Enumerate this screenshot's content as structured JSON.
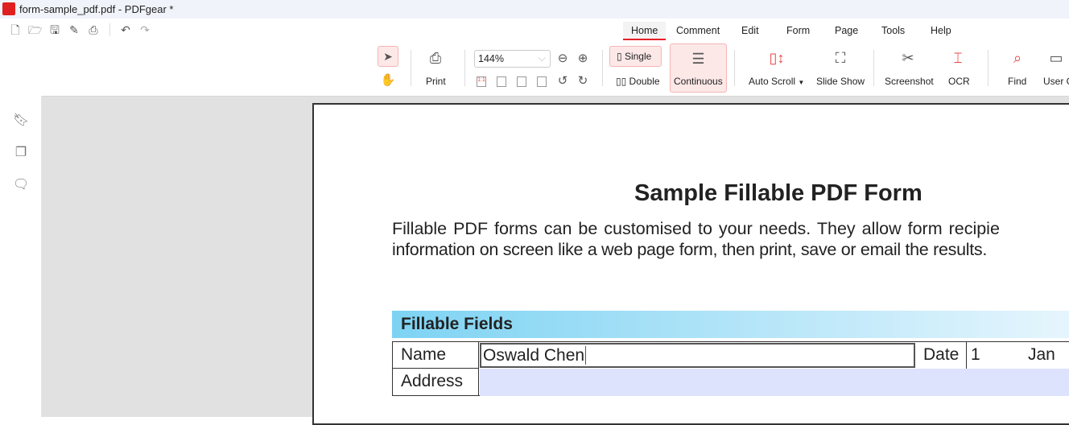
{
  "window": {
    "title": "form-sample_pdf.pdf - PDFgear *"
  },
  "quick_toolbar": {
    "icons": [
      "new-file-icon",
      "open-folder-icon",
      "save-icon",
      "save-as-icon",
      "print-icon",
      "undo-icon",
      "redo-icon"
    ]
  },
  "menu_tabs": [
    "Home",
    "Comment",
    "Edit",
    "Form",
    "Page",
    "Tools",
    "Help"
  ],
  "active_tab": "Home",
  "ribbon": {
    "print": "Print",
    "zoom_value": "144%",
    "single": "Single",
    "double": "Double",
    "continuous": "Continuous",
    "auto_scroll": "Auto Scroll",
    "slide_show": "Slide Show",
    "screenshot": "Screenshot",
    "ocr": "OCR",
    "find": "Find",
    "user": "User G"
  },
  "colors": {
    "accent": "#e8202a",
    "header_gradient_start": "#7dd3f3",
    "field_fill": "#dde3fd"
  },
  "document": {
    "heading": "Sample Fillable PDF Form",
    "intro_line1": "Fillable PDF forms can be customised to your needs. They allow form recipie",
    "intro_line2": "information on screen like a web page form, then print, save or email the results.",
    "section": "Fillable Fields",
    "name_label": "Name",
    "name_value": "Oswald Chen",
    "date_label": "Date",
    "date_day": "1",
    "date_month": "Jan",
    "address_label": "Address"
  }
}
